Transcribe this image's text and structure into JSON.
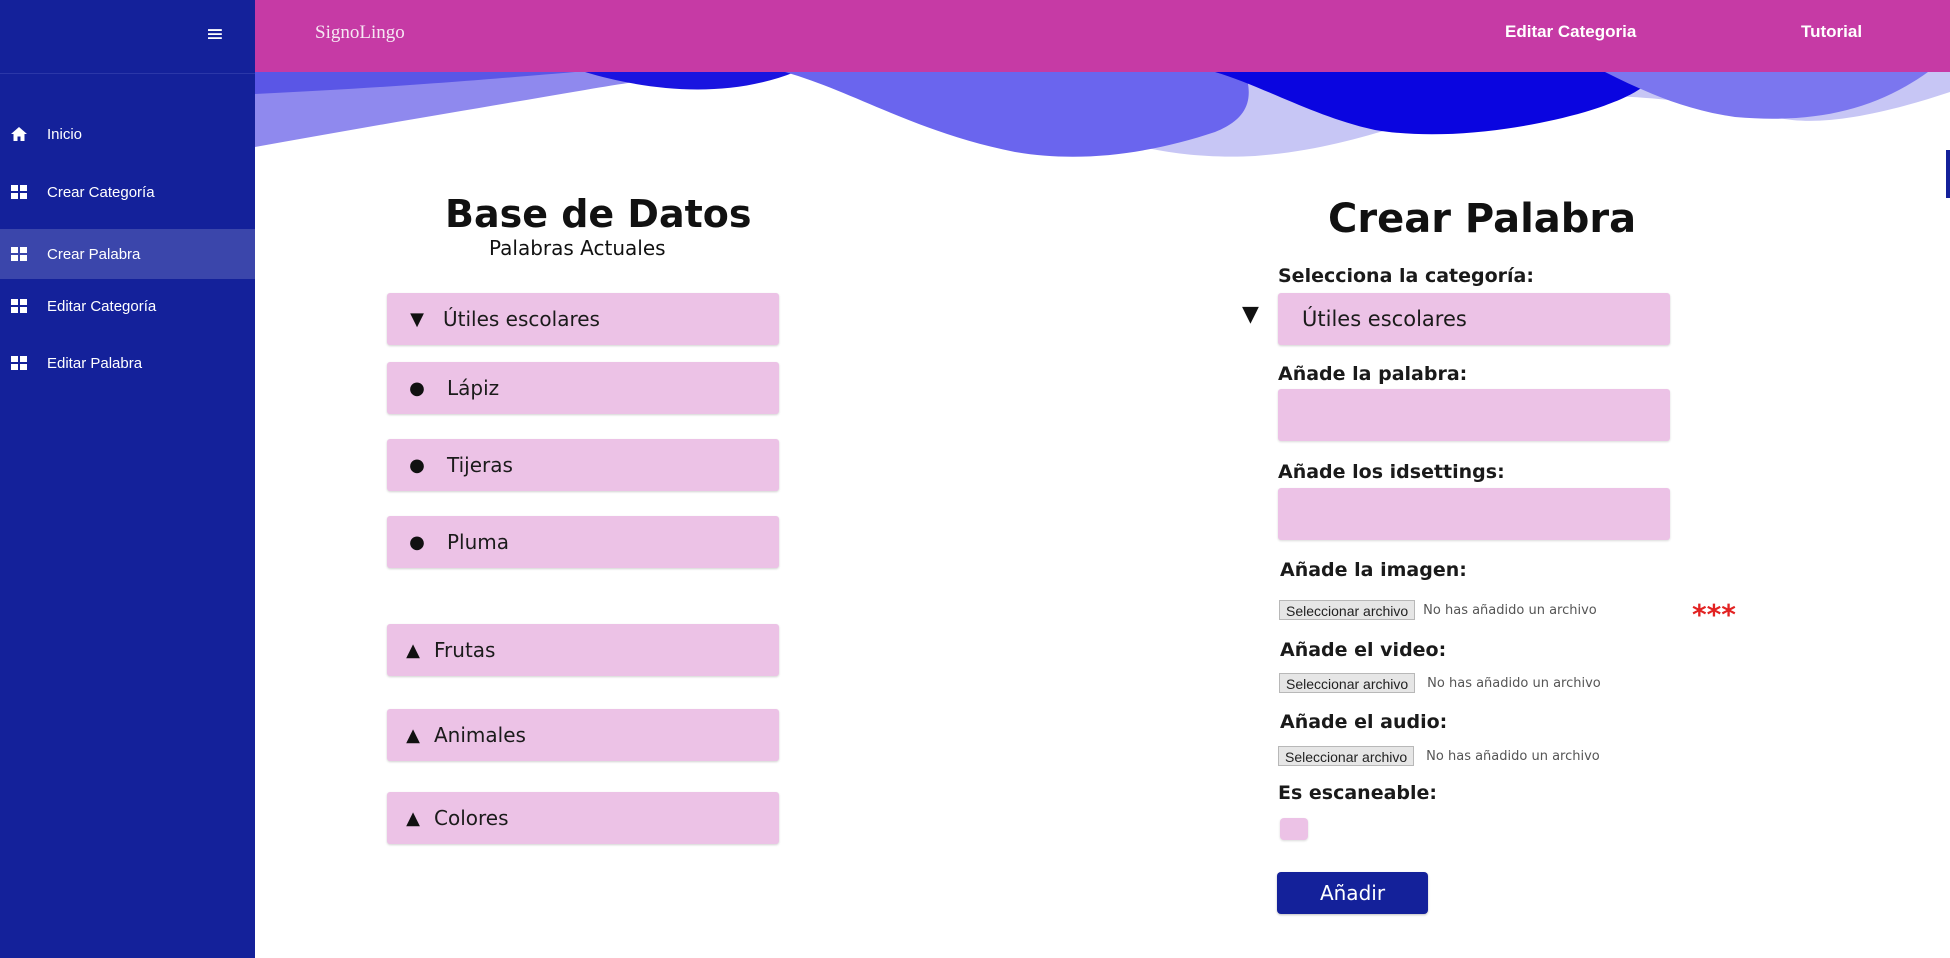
{
  "app": {
    "brand": "SignoLingo"
  },
  "header": {
    "nav": [
      "Editar Categoria",
      "Tutorial"
    ]
  },
  "sidebar": {
    "menu_icon": "hamburger-icon",
    "items": [
      {
        "label": "Inicio",
        "icon": "home-icon"
      },
      {
        "label": "Crear Categoría",
        "icon": "grid-icon"
      },
      {
        "label": "Crear Palabra",
        "icon": "grid-icon",
        "active": true
      },
      {
        "label": "Editar Categoría",
        "icon": "grid-icon"
      },
      {
        "label": "Editar Palabra",
        "icon": "grid-icon"
      }
    ]
  },
  "database": {
    "title": "Base de Datos",
    "subtitle": "Palabras Actuales",
    "expanded_category": {
      "symbol": "▼",
      "label": "Útiles escolares"
    },
    "words": [
      {
        "symbol": "●",
        "label": "Lápiz"
      },
      {
        "symbol": "●",
        "label": "Tijeras"
      },
      {
        "symbol": "●",
        "label": "Pluma"
      }
    ],
    "collapsed_categories": [
      {
        "symbol": "▲",
        "label": "Frutas"
      },
      {
        "symbol": "▲",
        "label": "Animales"
      },
      {
        "symbol": "▲",
        "label": "Colores"
      }
    ]
  },
  "form": {
    "title": "Crear Palabra",
    "category_label": "Selecciona la categoría:",
    "category_arrow": "▼",
    "category_value": "Útiles escolares",
    "word_label": "Añade la palabra:",
    "word_value": "",
    "idsettings_label": "Añade los idsettings:",
    "idsettings_value": "",
    "image_label": "Añade la imagen:",
    "video_label": "Añade el video:",
    "audio_label": "Añade el audio:",
    "file_button": "Seleccionar archivo",
    "no_file_text": "No has añadido un archivo",
    "required_mark": "***",
    "scannable_label": "Es escaneable:",
    "submit_label": "Añadir"
  },
  "colors": {
    "sidebar": "#14219a",
    "header": "#c63aa5",
    "pill": "#ecc2e6",
    "button": "#14219a"
  }
}
